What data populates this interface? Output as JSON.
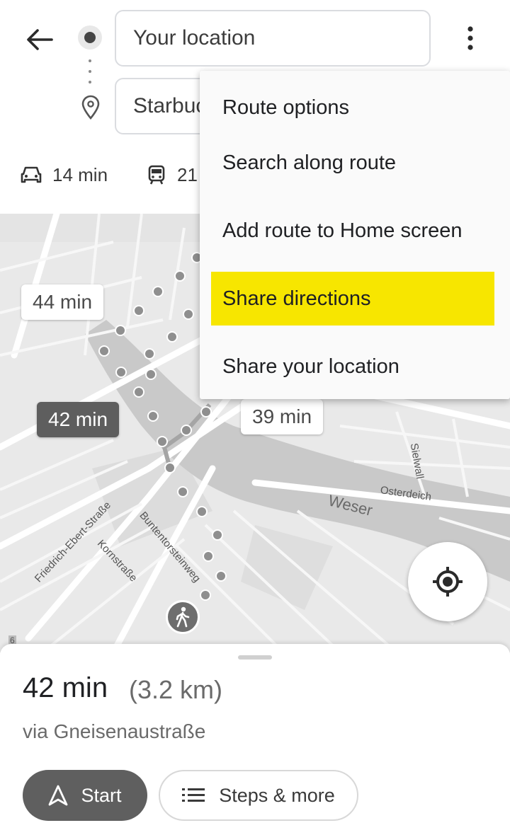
{
  "search": {
    "origin_value": "Your location",
    "destination_value": "Starbucks"
  },
  "modes": [
    {
      "icon": "car-icon",
      "label": "14 min"
    },
    {
      "icon": "transit-icon",
      "label": "21"
    }
  ],
  "menu": {
    "items": [
      {
        "label": "Route options",
        "highlighted": false
      },
      {
        "label": "Search along route",
        "highlighted": false
      },
      {
        "label": "Add route to Home screen",
        "highlighted": false
      },
      {
        "label": "Share directions",
        "highlighted": true
      },
      {
        "label": "Share your location",
        "highlighted": false
      }
    ],
    "highlight_color": "#f7e600"
  },
  "map": {
    "route_labels": [
      {
        "text": "44 min",
        "selected": false
      },
      {
        "text": "42 min",
        "selected": true
      },
      {
        "text": "39 min",
        "selected": false
      }
    ],
    "streets": [
      "Friedrich-Ebert-Straße",
      "Kornstraße",
      "Buntentorsteinweg",
      "Sielwall",
      "Osterdeich"
    ],
    "river": "Weser",
    "corner_mark": "6"
  },
  "sheet": {
    "duration": "42 min",
    "distance": "(3.2 km)",
    "via": "via Gneisenaustraße",
    "start_label": "Start",
    "steps_label": "Steps & more"
  },
  "colors": {
    "selected_route": "#5e5e5e",
    "map_background": "#e9e9e9",
    "river": "#c9c9c9",
    "route_dots": "#8f8f8f"
  }
}
